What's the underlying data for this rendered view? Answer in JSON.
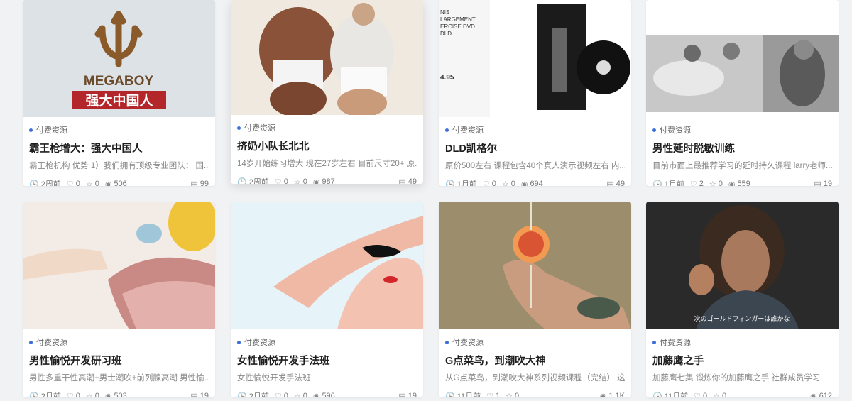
{
  "cards": [
    {
      "category": "付费资源",
      "title": "霸王枪增大：强大中国人",
      "desc": "霸王枪机构 优势 1）我们拥有顶级专业团队： 国...",
      "time": "2周前",
      "likes": "0",
      "favs": "0",
      "views": "506",
      "count": "99",
      "thumb_text": "MEGABOY",
      "thumb_text2": "强大中国人"
    },
    {
      "category": "付费资源",
      "title": "挤奶小队长北北",
      "desc": "14岁开始练习增大 现在27岁左右 目前尺寸20+ 原...",
      "time": "2周前",
      "likes": "0",
      "favs": "0",
      "views": "987",
      "count": "49"
    },
    {
      "category": "付费资源",
      "title": "DLD凯格尔",
      "desc": "原价500左右 课程包含40个真人演示视频左右 内...",
      "time": "1月前",
      "likes": "0",
      "favs": "0",
      "views": "694",
      "count": "49",
      "thumb_text": "NIS\nLARGEMENT\nERCISE DVD\nDLD",
      "thumb_text2": "4.95"
    },
    {
      "category": "付费资源",
      "title": "男性延时脱敏训练",
      "desc": "目前市面上最推荐学习的延时持久课程 larry老师...",
      "time": "1月前",
      "likes": "2",
      "favs": "0",
      "views": "559",
      "count": "19"
    },
    {
      "category": "付费资源",
      "title": "男性愉悦开发研习班",
      "desc": "男性多重干性高潮+男士潮吹+前列腺高潮 男性愉...",
      "time": "2月前",
      "likes": "0",
      "favs": "0",
      "views": "503",
      "count": "19"
    },
    {
      "category": "付费资源",
      "title": "女性愉悦开发手法班",
      "desc": "女性愉悦开发手法班",
      "time": "2月前",
      "likes": "0",
      "favs": "0",
      "views": "596",
      "count": "19"
    },
    {
      "category": "付费资源",
      "title": "G点菜鸟，到潮吹大神",
      "desc": "从G点菜鸟，到潮吹大神系列视频课程（完结） 这...",
      "time": "11月前",
      "likes": "1",
      "favs": "0",
      "views": "1.1K",
      "count": ""
    },
    {
      "category": "付费资源",
      "title": "加藤鹰之手",
      "desc": "加藤鹰七集 锻炼你的加藤鹰之手 社群成员学习",
      "time": "11月前",
      "likes": "0",
      "favs": "0",
      "views": "612",
      "count": "",
      "thumb_text": "次のゴールドフィンガーは誰かな"
    }
  ],
  "icons": {
    "time": "clock-icon",
    "like": "heart-icon",
    "fav": "star-icon",
    "view": "eye-icon",
    "count": "stack-icon"
  },
  "colors": {
    "accent": "#3d6fdc",
    "background": "#f1f2f4"
  }
}
